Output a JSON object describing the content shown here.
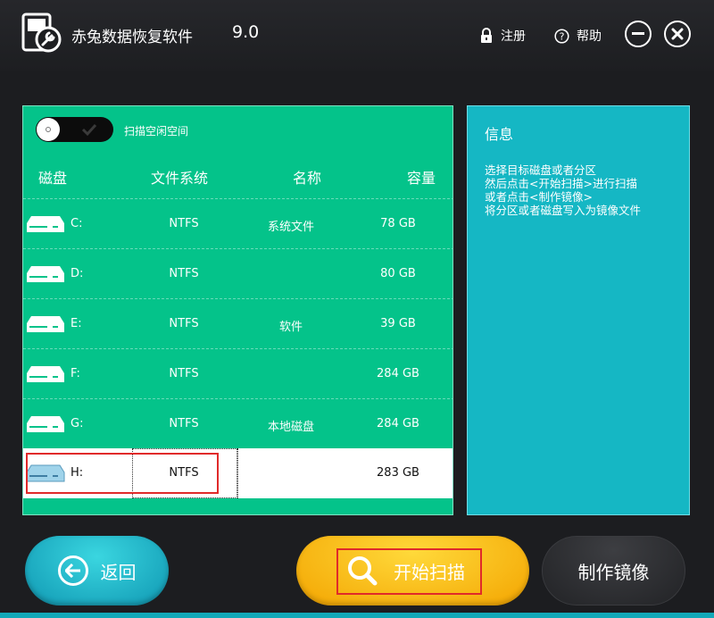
{
  "app": {
    "title": "赤兔数据恢复软件",
    "version": "9.0",
    "register_label": "注册",
    "help_label": "帮助",
    "icons": {
      "logo": "disk-wrench-icon",
      "register": "lock-icon",
      "help": "question-circle-icon",
      "minimize": "minus-circle-icon",
      "close": "close-circle-icon"
    }
  },
  "disk_panel": {
    "toggle_label": "扫描空闲空间",
    "toggle_on": false,
    "headers": {
      "disk": "磁盘",
      "filesystem": "文件系统",
      "name": "名称",
      "capacity": "容量"
    },
    "rows": [
      {
        "letter": "C:",
        "filesystem": "NTFS",
        "name": "系统文件",
        "capacity": "78 GB"
      },
      {
        "letter": "D:",
        "filesystem": "NTFS",
        "name": "",
        "capacity": "80 GB"
      },
      {
        "letter": "E:",
        "filesystem": "NTFS",
        "name": "软件",
        "capacity": "39 GB"
      },
      {
        "letter": "F:",
        "filesystem": "NTFS",
        "name": "",
        "capacity": "284 GB"
      },
      {
        "letter": "G:",
        "filesystem": "NTFS",
        "name": "本地磁盘",
        "capacity": "284 GB"
      },
      {
        "letter": "H:",
        "filesystem": "NTFS",
        "name": "",
        "capacity": "283 GB"
      }
    ],
    "selected_row": 5
  },
  "info_panel": {
    "title": "信息",
    "lines": [
      "选择目标磁盘或者分区",
      "然后点击<开始扫描>进行扫描",
      "或者点击<制作镜像>",
      "将分区或者磁盘写入为镜像文件"
    ]
  },
  "buttons": {
    "back": "返回",
    "scan": "开始扫描",
    "image": "制作镜像"
  },
  "colors": {
    "disk_panel": "#04c38a",
    "info_panel": "#15b7c4",
    "scan_button": "#f7b800",
    "back_button": "#1ab4c8",
    "highlight": "#e02a2a"
  }
}
